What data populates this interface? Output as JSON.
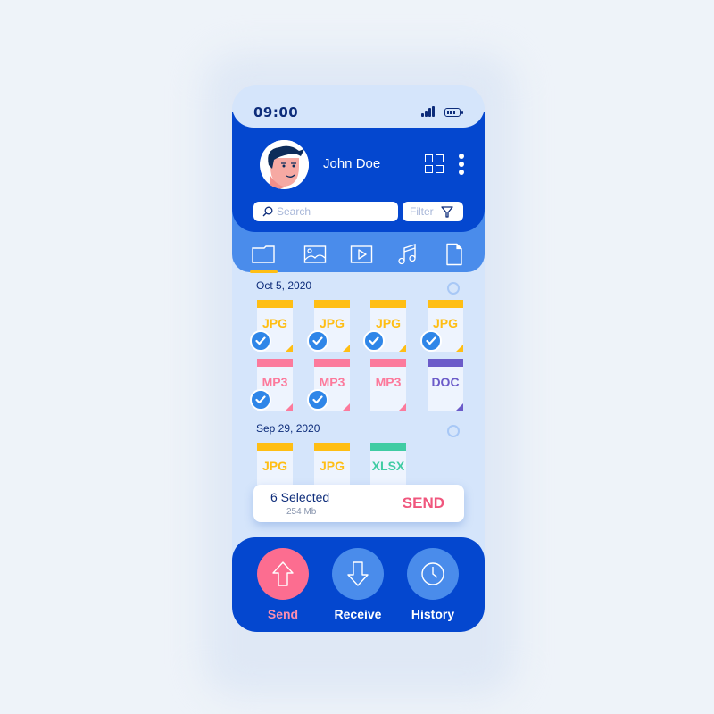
{
  "status_bar": {
    "time": "09:00",
    "signal_icon": "signal-icon",
    "battery_icon": "battery-icon"
  },
  "header": {
    "user_name": "John Doe",
    "avatar_icon": "user-avatar",
    "grid_icon": "grid-view-icon",
    "menu_icon": "more-vertical-icon",
    "search": {
      "placeholder": "Search",
      "value": ""
    },
    "filter": {
      "label": "Filter",
      "icon": "filter-icon"
    }
  },
  "tabs": [
    {
      "name": "folders",
      "icon": "folder-icon",
      "active": true
    },
    {
      "name": "images",
      "icon": "image-icon",
      "active": false
    },
    {
      "name": "videos",
      "icon": "video-play-icon",
      "active": false
    },
    {
      "name": "music",
      "icon": "music-note-icon",
      "active": false
    },
    {
      "name": "documents",
      "icon": "document-icon",
      "active": false
    }
  ],
  "groups": [
    {
      "date": "Oct 5, 2020",
      "files": [
        {
          "ext": "JPG",
          "selected": true
        },
        {
          "ext": "JPG",
          "selected": true
        },
        {
          "ext": "JPG",
          "selected": true
        },
        {
          "ext": "JPG",
          "selected": true
        },
        {
          "ext": "MP3",
          "selected": true
        },
        {
          "ext": "MP3",
          "selected": true
        },
        {
          "ext": "MP3",
          "selected": false
        },
        {
          "ext": "DOC",
          "selected": false
        }
      ]
    },
    {
      "date": "Sep 29, 2020",
      "files": [
        {
          "ext": "JPG",
          "selected": false
        },
        {
          "ext": "JPG",
          "selected": false
        },
        {
          "ext": "XLSX",
          "selected": false
        }
      ]
    }
  ],
  "selection": {
    "count_label": "6 Selected",
    "size": "254 Mb",
    "send_label": "SEND"
  },
  "bottom_nav": [
    {
      "label": "Send",
      "icon": "arrow-up-icon",
      "active": true
    },
    {
      "label": "Receive",
      "icon": "arrow-down-icon",
      "active": false
    },
    {
      "label": "History",
      "icon": "clock-icon",
      "active": false
    }
  ],
  "colors": {
    "primary": "#0447cf",
    "tab_bar": "#4a8ceb",
    "background": "#d5e5fb",
    "accent_send": "#f0567d",
    "jpg": "#ffbe14",
    "mp3": "#fc7a9c",
    "doc": "#6b5bc9",
    "xlsx": "#3fcca3",
    "check": "#2f86e8"
  }
}
